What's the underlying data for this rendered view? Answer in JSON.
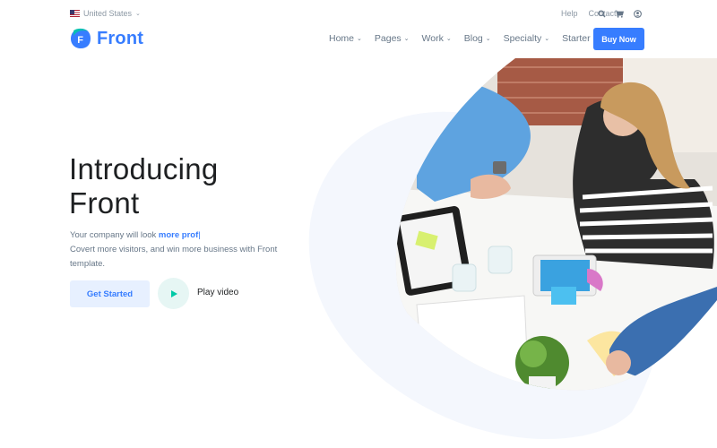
{
  "topbar": {
    "language": "United States",
    "links": [
      "Help",
      "Contacts"
    ],
    "icons": [
      "search-icon",
      "cart-icon",
      "user-icon"
    ]
  },
  "brand": {
    "logo_letter": "F",
    "name": "Front",
    "color": "#377dff"
  },
  "nav": {
    "items": [
      "Home",
      "Pages",
      "Work",
      "Blog",
      "Specialty",
      "Starter"
    ],
    "cta": "Buy Now"
  },
  "hero": {
    "title_line1": "Introducing",
    "title_line2": "Front",
    "sub_prefix": "Your company will look ",
    "sub_highlight": "more prof",
    "sub_cursor": "|",
    "sub_line2": "Covert more visitors, and win more business with Front",
    "sub_line3": "template.",
    "primary_button": "Get Started",
    "video_label": "Play video"
  },
  "colors": {
    "accent": "#377dff",
    "accent_soft": "#e7f0ff",
    "play_bg": "#e6f6f4",
    "play_icon": "#00c9a7",
    "blob": "#f4f7fd"
  }
}
